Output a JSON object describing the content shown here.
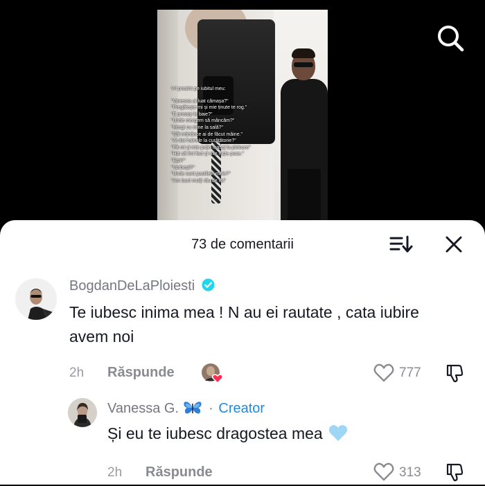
{
  "video": {
    "caption_title": "V-l prezint pe iubitul meu:",
    "caption_lines": [
      "\"Vanessa ai luat cămașa?\"",
      "\"Pregătește mi și mie ținute te rog.\"",
      "\"E prosop la baie?\"",
      "\"Unde mergem să mâncăm?\"",
      "\"Mergi cu mine la sală?\"",
      "\"Săl mânânce ai de făcut mâine.\"",
      "\"Ai dat hainele la curățătorie?\"",
      "\"Fă-mi și mie puțin masaj la picioare\"",
      "\"Hai să îmi faci și mie niște poze.\"",
      "\"Ești?\"",
      "\"Vorbești?\"",
      "\"Unde sunt pastilele mele?\"",
      "\"Am bani mulți rău de tot\""
    ]
  },
  "icons": {
    "search": "search-icon",
    "sort": "sort-icon",
    "close": "close-icon",
    "verified": "verified-badge-icon",
    "butterfly": "butterfly-emoji-icon",
    "heart": "heart-icon",
    "dislike": "dislike-icon",
    "liked_by_creator": "creator-liked-icon",
    "blue_heart": "blue-heart-emoji-icon"
  },
  "colors": {
    "verified": "#20d5ec",
    "creator": "#1e8ae0",
    "creator_heart": "#fe2c55",
    "blue_heart": "#9fd6f5"
  },
  "sheet": {
    "count_label": "73 de comentarii"
  },
  "comments": [
    {
      "username": "BogdanDeLaPloiesti",
      "text": "Te iubesc inima mea ! N au ei rautate , cata iubire avem noi",
      "time": "2h",
      "reply_label": "Răspunde",
      "likes": "777"
    },
    {
      "username": "Vanessa G.",
      "separator": "·",
      "creator_label": "Creator",
      "text": "Și eu te iubesc dragostea mea",
      "time": "2h",
      "reply_label": "Răspunde",
      "likes": "313"
    }
  ]
}
